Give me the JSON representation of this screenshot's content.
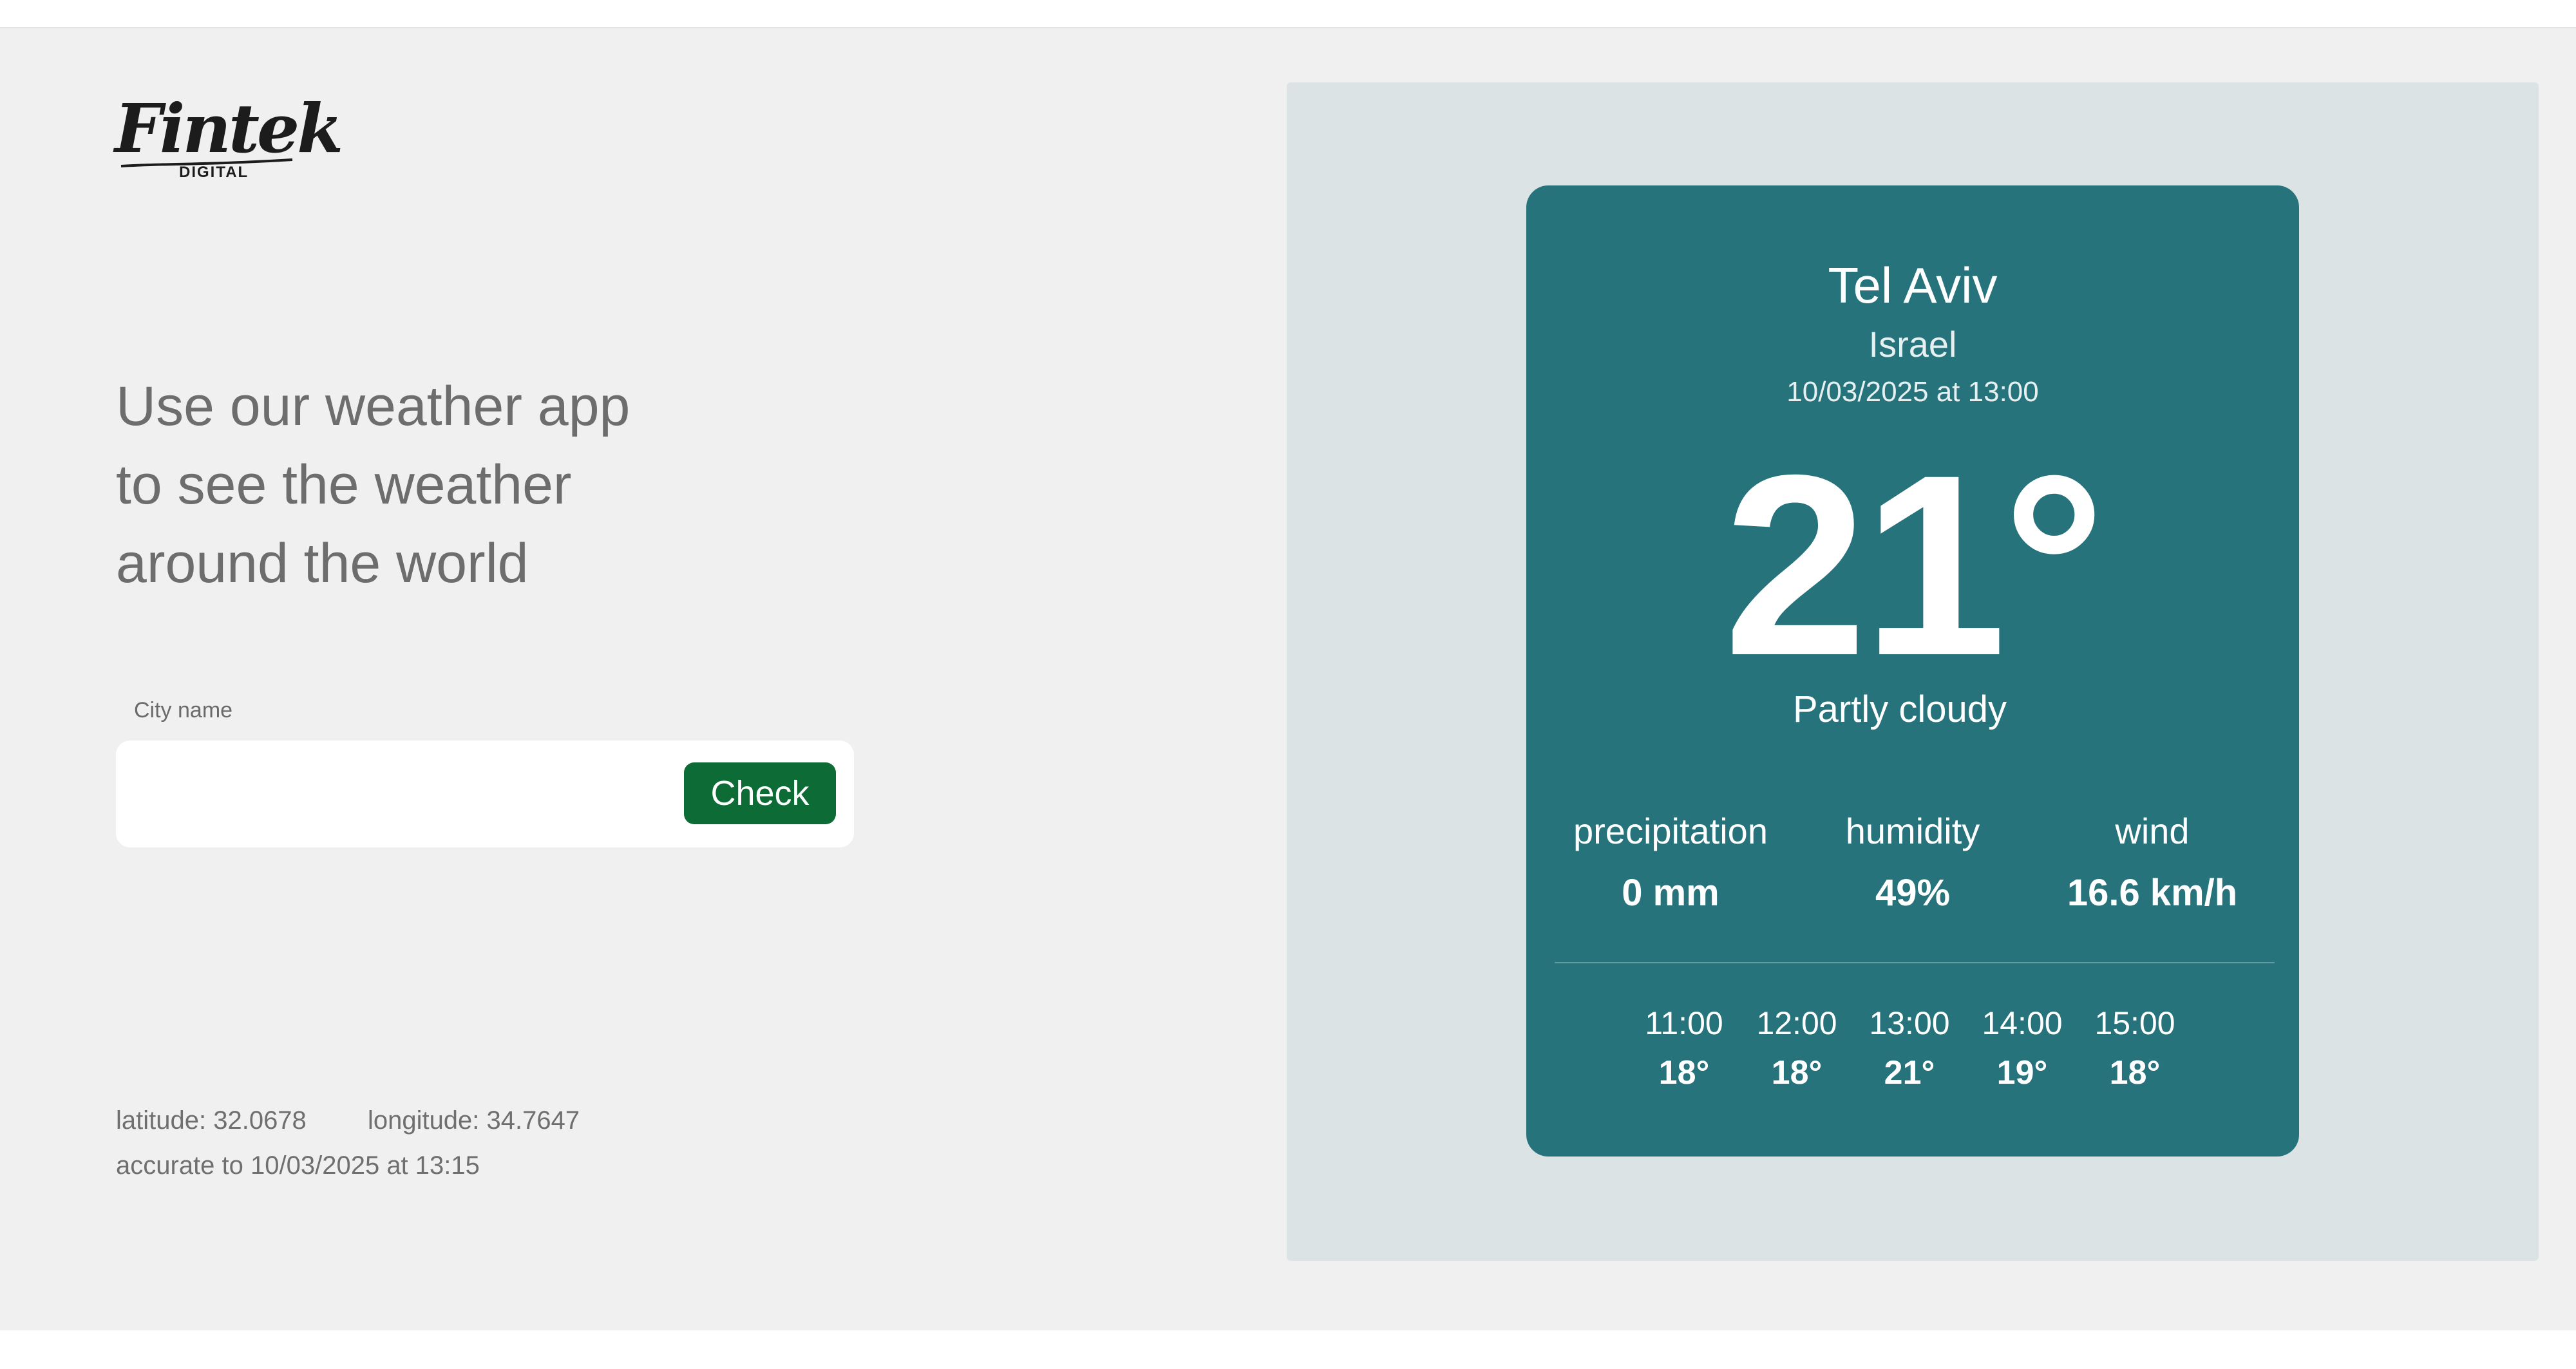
{
  "logo": {
    "brand": "Fintek",
    "sub": "DIGITAL"
  },
  "headline": {
    "line1": "Use our weather app",
    "line2": "to see the weather",
    "line3": "around the world"
  },
  "search": {
    "label": "City name",
    "value": "",
    "placeholder": "",
    "button_label": "Check"
  },
  "location": {
    "latitude_text": "latitude: 32.0678",
    "longitude_text": "longitude: 34.7647",
    "accuracy_text": "accurate to 10/03/2025 at 13:15"
  },
  "weather": {
    "city": "Tel Aviv",
    "country": "Israel",
    "datetime": "10/03/2025 at 13:00",
    "temperature": "21°",
    "condition": "Partly cloudy",
    "stats": [
      {
        "label": "precipitation",
        "value": "0 mm"
      },
      {
        "label": "humidity",
        "value": "49%"
      },
      {
        "label": "wind",
        "value": "16.6 km/h"
      }
    ],
    "hourly": [
      {
        "time": "11:00",
        "temp": "18°"
      },
      {
        "time": "12:00",
        "temp": "18°"
      },
      {
        "time": "13:00",
        "temp": "21°"
      },
      {
        "time": "14:00",
        "temp": "19°"
      },
      {
        "time": "15:00",
        "temp": "18°"
      }
    ]
  },
  "colors": {
    "page_bg": "#f0f0f0",
    "panel_bg": "#dce3e5",
    "card_bg": "#26737c",
    "button_bg": "#0d6b35",
    "text_gray": "#6d6d6d"
  }
}
